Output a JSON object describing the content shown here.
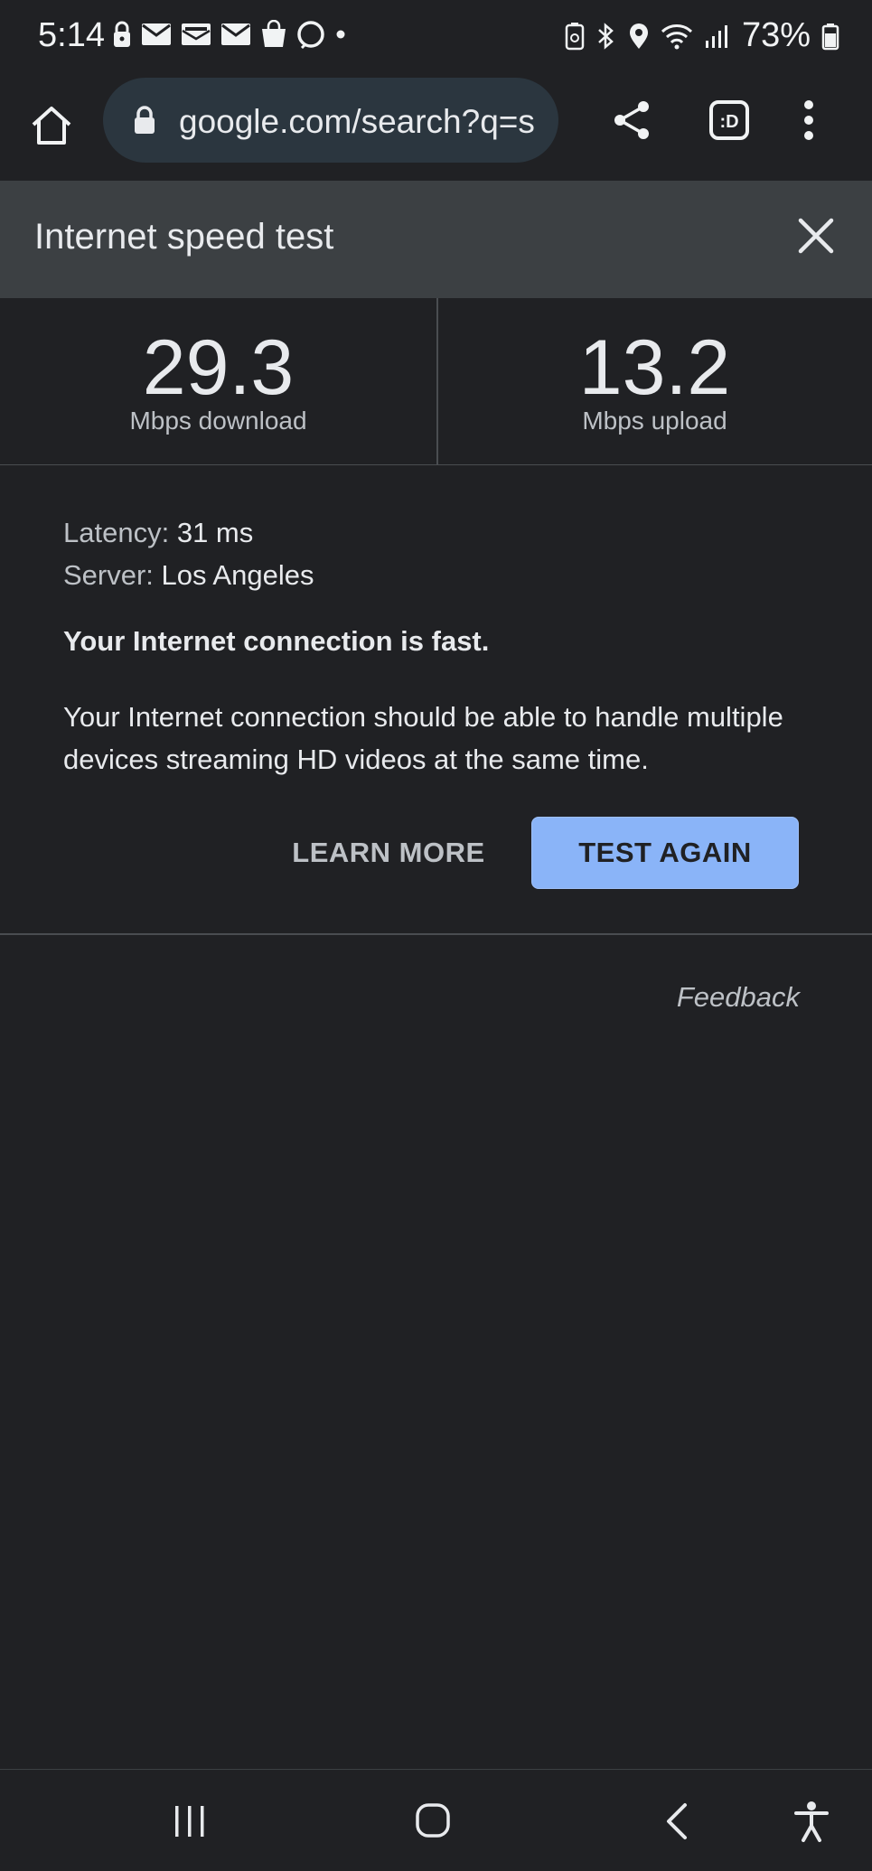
{
  "status_bar": {
    "time": "5:14",
    "battery_percent": "73%"
  },
  "toolbar": {
    "url": "google.com/search?q=s",
    "tabs_label": ":D"
  },
  "card": {
    "title": "Internet speed test",
    "download": {
      "value": "29.3",
      "label": "Mbps download"
    },
    "upload": {
      "value": "13.2",
      "label": "Mbps upload"
    },
    "latency": {
      "key": "Latency:",
      "value": "31 ms"
    },
    "server": {
      "key": "Server:",
      "value": "Los Angeles"
    },
    "verdict": "Your Internet connection is fast.",
    "description": "Your Internet connection should be able to handle multiple devices streaming HD videos at the same time.",
    "learn_more_label": "LEARN MORE",
    "test_again_label": "TEST AGAIN",
    "feedback_label": "Feedback"
  },
  "colors": {
    "background": "#202124",
    "header": "#3c4043",
    "accent": "#8ab4f8",
    "url_pill": "#2b363f"
  },
  "icons": [
    "lock-icon",
    "mail-icon",
    "shopping-bag-icon",
    "alexa-icon",
    "dot-icon",
    "battery-saver-icon",
    "bluetooth-icon",
    "location-icon",
    "wifi-icon",
    "signal-icon",
    "battery-icon",
    "home-icon",
    "share-icon",
    "tab-switcher-icon",
    "more-vert-icon",
    "close-icon",
    "recents-icon",
    "home-nav-icon",
    "back-icon",
    "accessibility-icon"
  ]
}
